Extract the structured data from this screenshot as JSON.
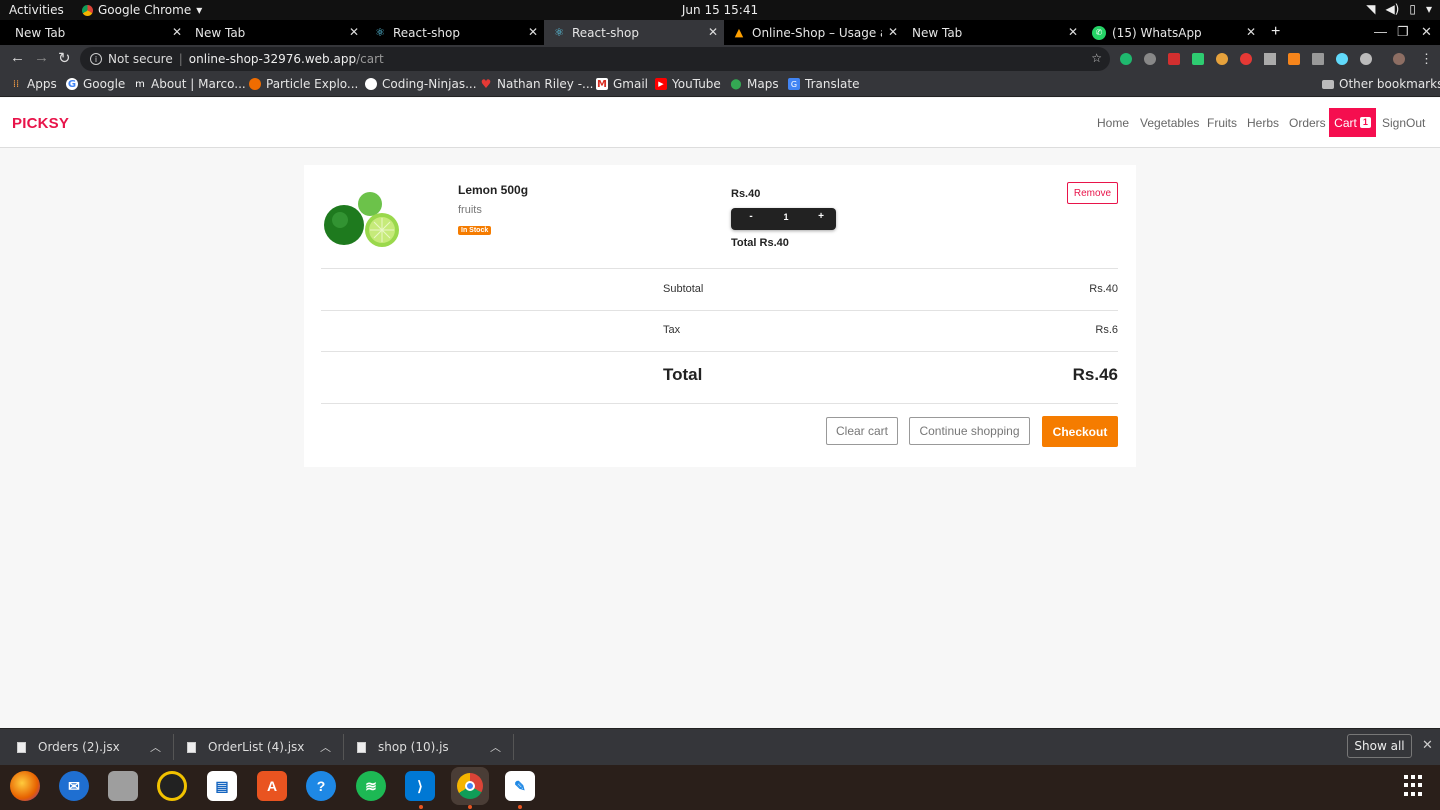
{
  "gnome": {
    "activities": "Activities",
    "app_name": "Google Chrome",
    "clock": "Jun 15  15:41"
  },
  "tabs": [
    {
      "label": "New Tab",
      "favicon": "none"
    },
    {
      "label": "New Tab",
      "favicon": "none"
    },
    {
      "label": "React-shop",
      "favicon": "react-icon"
    },
    {
      "label": "React-shop",
      "favicon": "react-icon"
    },
    {
      "label": "Online-Shop – Usage and",
      "favicon": "firebase-icon"
    },
    {
      "label": "New Tab",
      "favicon": "none"
    },
    {
      "label": "(15) WhatsApp",
      "favicon": "whatsapp-icon"
    }
  ],
  "omnibox": {
    "security": "Not secure",
    "host": "online-shop-32976.web.app",
    "path": "/cart"
  },
  "bookmarks": [
    {
      "label": "Apps",
      "icon": "apps-grid-icon"
    },
    {
      "label": "Google",
      "icon": "google-icon"
    },
    {
      "label": "About | Marco...",
      "icon": "m-icon"
    },
    {
      "label": "Particle Explo...",
      "icon": "particle-icon"
    },
    {
      "label": "Coding-Ninjas...",
      "icon": "github-icon"
    },
    {
      "label": "Nathan Riley -...",
      "icon": "heart-icon"
    },
    {
      "label": "Gmail",
      "icon": "gmail-icon"
    },
    {
      "label": "YouTube",
      "icon": "youtube-icon"
    },
    {
      "label": "Maps",
      "icon": "maps-icon"
    },
    {
      "label": "Translate",
      "icon": "translate-icon"
    }
  ],
  "other_bookmarks": "Other bookmarks",
  "site": {
    "brand": "PICKSY",
    "nav": [
      "Home",
      "Vegetables",
      "Fruits",
      "Herbs",
      "Orders"
    ],
    "cart_label": "Cart",
    "cart_count": "1",
    "signout": "SignOut",
    "brand_color": "#e8144a",
    "accent_color": "#f57c00"
  },
  "cart": {
    "item": {
      "name": "Lemon 500g",
      "category": "fruits",
      "stock": "In Stock",
      "unit_price": "Rs.40",
      "qty_minus": "-",
      "quantity": "1",
      "qty_plus": "+",
      "line_total": "Total Rs.40",
      "remove": "Remove"
    },
    "summary": {
      "subtotal_label": "Subtotal",
      "subtotal": "Rs.40",
      "tax_label": "Tax",
      "tax": "Rs.6",
      "total_label": "Total",
      "total": "Rs.46"
    },
    "actions": {
      "clear": "Clear cart",
      "continue": "Continue shopping",
      "checkout": "Checkout"
    }
  },
  "downloads": [
    {
      "name": "Orders (2).jsx"
    },
    {
      "name": "OrderList (4).jsx"
    },
    {
      "name": "shop (10).js"
    }
  ],
  "show_all": "Show all",
  "dock": [
    "firefox-icon",
    "thunderbird-icon",
    "files-icon",
    "rhythmbox-icon",
    "writer-icon",
    "software-icon",
    "help-icon",
    "spotify-icon",
    "vscode-icon",
    "chrome-icon",
    "text-editor-icon"
  ]
}
